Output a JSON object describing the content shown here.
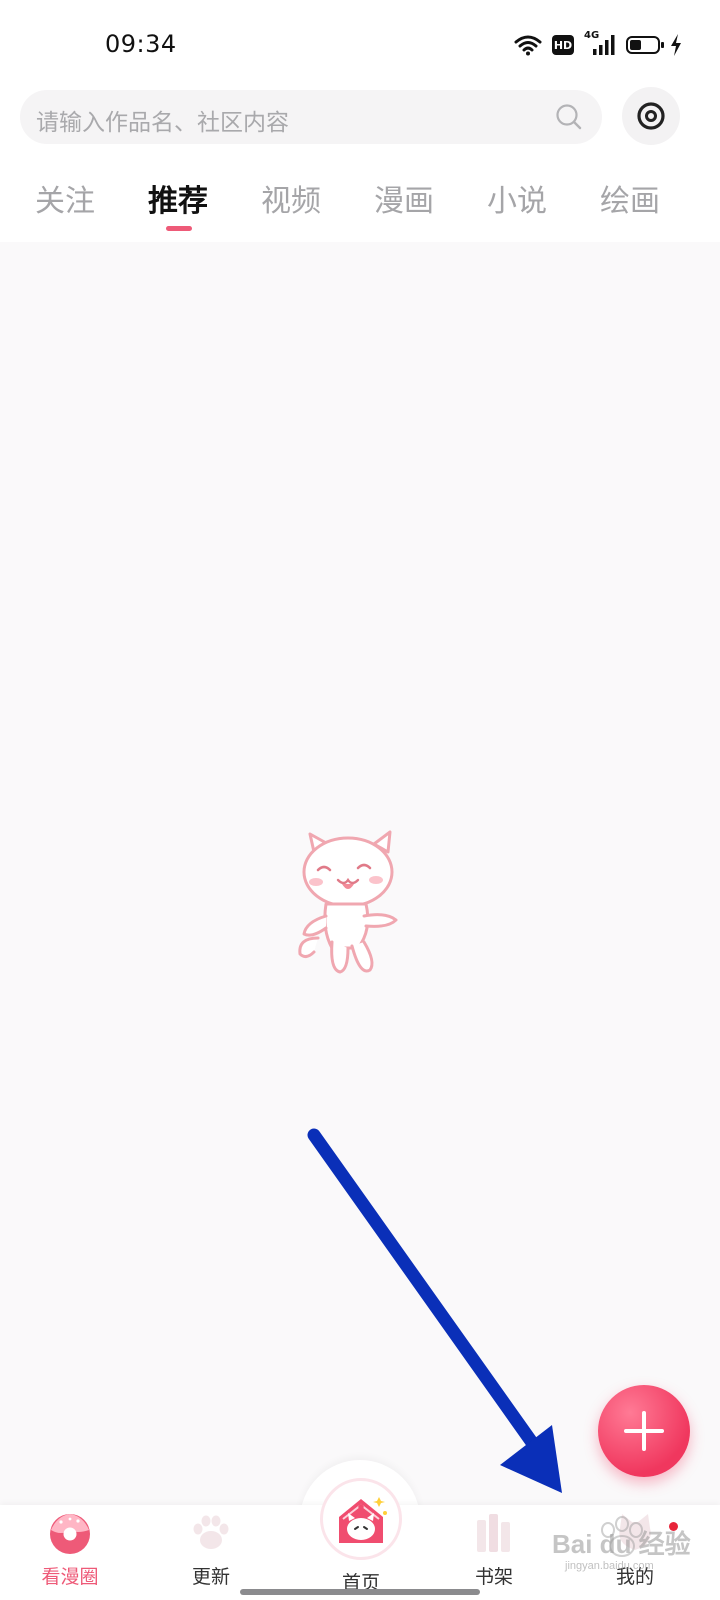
{
  "status_bar": {
    "time": "09:34",
    "hd_badge": "HD",
    "network": "4G",
    "battery_level": 0.45,
    "charging": true
  },
  "search": {
    "placeholder": "请输入作品名、社区内容",
    "search_icon": "search-icon",
    "scan_icon": "scan-icon"
  },
  "tabs": [
    {
      "label": "关注",
      "active": false
    },
    {
      "label": "推荐",
      "active": true
    },
    {
      "label": "视频",
      "active": false
    },
    {
      "label": "漫画",
      "active": false
    },
    {
      "label": "小说",
      "active": false
    },
    {
      "label": "绘画",
      "active": false
    }
  ],
  "content": {
    "state": "loading",
    "mascot_icon": "dancing-cat-icon"
  },
  "fab": {
    "icon": "plus-icon"
  },
  "bottom_nav": [
    {
      "label": "看漫圈",
      "icon": "donut-icon",
      "active": true
    },
    {
      "label": "更新",
      "icon": "paw-icon",
      "active": false
    },
    {
      "label": "首页",
      "icon": "cat-house-icon",
      "active": false
    },
    {
      "label": "书架",
      "icon": "books-icon",
      "active": false
    },
    {
      "label": "我的",
      "icon": "cat-avatar-icon",
      "active": false,
      "has_badge": true
    }
  ],
  "watermark": {
    "text": "Bai du 经验",
    "url": "jingyan.baidu.com"
  },
  "colors": {
    "accent": "#ee5a78",
    "fab": "#f0375e",
    "annotation_arrow": "#0a2fb8",
    "background": "#faf9fa"
  }
}
